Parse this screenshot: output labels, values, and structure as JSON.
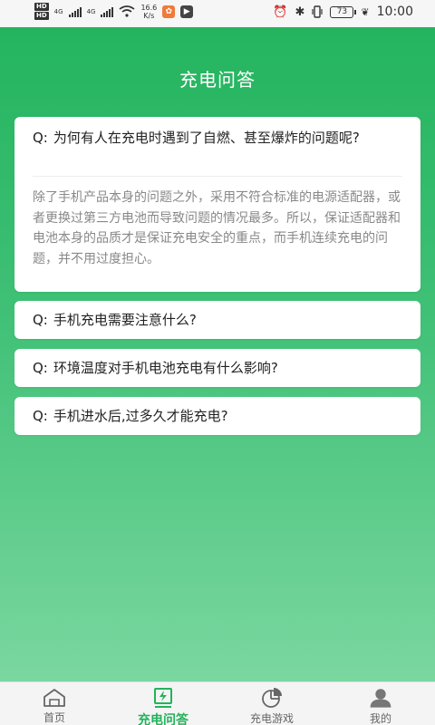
{
  "status_bar": {
    "hd_top": "HD",
    "hd_bottom": "HD",
    "net1": "4G",
    "net2": "4G",
    "speed_value": "16.6",
    "speed_unit": "K/s",
    "battery": "73",
    "time": "10:00"
  },
  "page": {
    "title": "充电问答"
  },
  "faq": {
    "prefix": "Q:",
    "items": [
      {
        "question": "为何有人在充电时遇到了自燃、甚至爆炸的问题呢?",
        "answer": "除了手机产品本身的问题之外，采用不符合标准的电源适配器，或者更换过第三方电池而导致问题的情况最多。所以，保证适配器和电池本身的品质才是保证充电安全的重点，而手机连续充电的问题，并不用过度担心。"
      },
      {
        "question": "手机充电需要注意什么?"
      },
      {
        "question": "环境温度对手机电池充电有什么影响?"
      },
      {
        "question": "手机进水后,过多久才能充电?"
      }
    ]
  },
  "nav": {
    "items": [
      {
        "label": "首页",
        "icon": "home-icon"
      },
      {
        "label": "充电问答",
        "icon": "charge-qa-icon",
        "active": true
      },
      {
        "label": "充电游戏",
        "icon": "pie-chart-icon"
      },
      {
        "label": "我的",
        "icon": "user-icon"
      }
    ]
  },
  "colors": {
    "primary": "#22b35b",
    "nav_inactive": "#666666"
  }
}
